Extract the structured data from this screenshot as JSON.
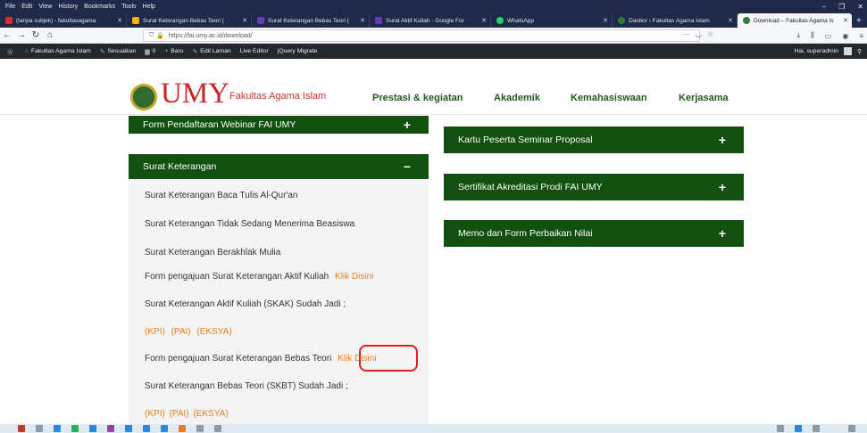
{
  "menubar": {
    "items": [
      "File",
      "Edit",
      "View",
      "History",
      "Bookmarks",
      "Tools",
      "Help"
    ]
  },
  "tabs": [
    {
      "title": "(tanpa subjek) - fakultasagama",
      "icon": "gmail-icon",
      "color": "#d93025"
    },
    {
      "title": "Surat Keterangan Bebas Teori (",
      "icon": "docs-icon",
      "color": "#f4b400"
    },
    {
      "title": "Surat Keterangan Bebas Teori (",
      "icon": "forms-icon",
      "color": "#673ab7"
    },
    {
      "title": "Surat Aktif Kuliah - Google For",
      "icon": "forms-icon",
      "color": "#673ab7"
    },
    {
      "title": "WhatsApp",
      "icon": "whatsapp-icon",
      "color": "#25d366"
    },
    {
      "title": "Dasbor › Fakultas Agama Islam",
      "icon": "site-icon",
      "color": "#2e7d32"
    },
    {
      "title": "Download – Fakultas Agama Is",
      "icon": "site-icon",
      "color": "#2e7d32"
    }
  ],
  "url": {
    "host": "https://fai.umy.ac.id",
    "path": "/download/"
  },
  "adminbar": {
    "site": "Fakultas Agama Islam",
    "customize": "Sesuaikan",
    "comments": "0",
    "new": "Baru",
    "edit": "Edit Laman",
    "live_editor": "Live Editor",
    "jquery": "jQuery Migrate",
    "greeting": "Hai, superadmin"
  },
  "site": {
    "brand": "UMY",
    "subtitle": "Fakultas Agama Islam",
    "nav": [
      "Prestasi & kegiatan",
      "Akademik",
      "Kemahasiswaan",
      "Kerjasama"
    ]
  },
  "left": {
    "webinar": {
      "label": "Form Pendaftaran Webinar FAI UMY",
      "sign": "+"
    },
    "surat": {
      "label": "Surat Keterangan",
      "sign": "−"
    },
    "items": [
      {
        "text": "Surat Keterangan Baca Tulis Al-Qur'an"
      },
      {
        "text": "Surat Keterangan Tidak Sedang Menerima Beasiswa"
      },
      {
        "text": "Surat Keterangan Berakhlak Mulia"
      },
      {
        "text": "Form pengajuan Surat Keterangan Aktif Kuliah",
        "link": "Klik Disini"
      },
      {
        "text": "Surat Keterangan Aktif Kuliah (SKAK) Sudah Jadi ;"
      },
      {
        "links": [
          "(KPI)",
          "(PAI)",
          "(EKSYA)"
        ]
      },
      {
        "text": "Form pengajuan Surat Keterangan Bebas Teori",
        "link": "Klik Disini"
      },
      {
        "text": "Surat Keterangan Bebas Teori (SKBT) Sudah Jadi ;"
      },
      {
        "links": [
          "(KPI)",
          "(PAI)",
          "(EKSYA)"
        ]
      }
    ]
  },
  "right": [
    {
      "label": "Kartu Peserta Seminar Proposal",
      "sign": "+"
    },
    {
      "label": "Sertifikat Akreditasi Prodi FAI UMY",
      "sign": "+"
    },
    {
      "label": "Memo dan Form Perbaikan Nilai",
      "sign": "+"
    }
  ],
  "colors": {
    "accordion": "#12500f",
    "link": "#e67e22",
    "brand": "#c62828",
    "highlight": "#e02020"
  }
}
